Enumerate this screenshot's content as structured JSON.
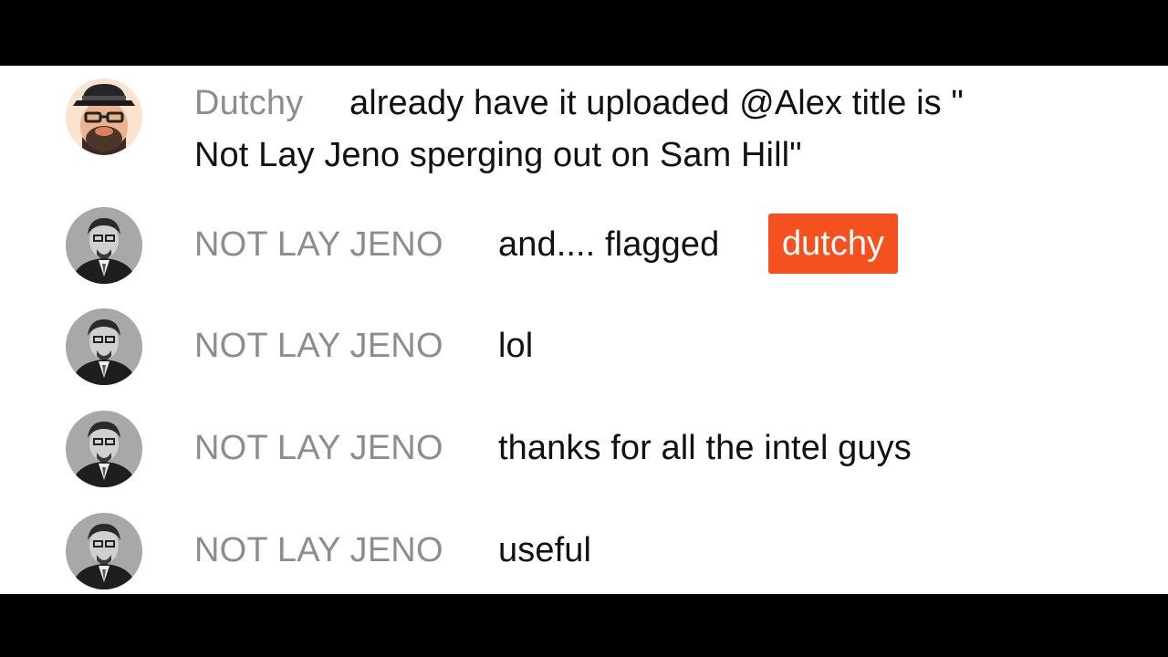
{
  "chat": {
    "messages": [
      {
        "author": "Dutchy",
        "text_line1": "already have it uploaded @Alex title is \"",
        "text_line2": "Not Lay Jeno sperging out on Sam Hill\"",
        "avatar": "bearded-man-with-hat-avatar"
      },
      {
        "author": "NOT LAY JENO",
        "text": "and.... flagged",
        "mention": "dutchy",
        "mention_color": "#f4511e",
        "avatar": "man-portrait-avatar"
      },
      {
        "author": "NOT LAY JENO",
        "text": "lol",
        "avatar": "man-portrait-avatar"
      },
      {
        "author": "NOT LAY JENO",
        "text": "thanks for all the intel guys",
        "avatar": "man-portrait-avatar"
      },
      {
        "author": "NOT LAY JENO",
        "text": "useful",
        "avatar": "man-portrait-avatar"
      }
    ]
  },
  "colors": {
    "author": "#8d8d8d",
    "message_text": "#111111",
    "background": "#ffffff",
    "letterbox": "#000000"
  }
}
